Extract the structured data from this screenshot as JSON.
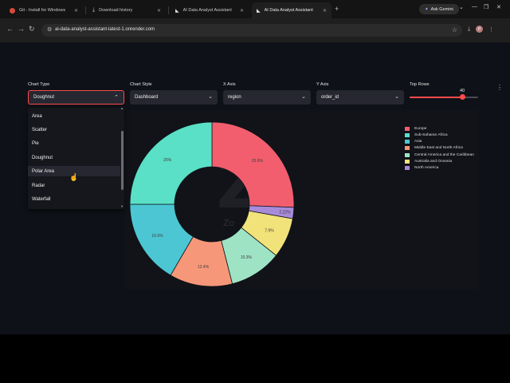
{
  "browser": {
    "tabs": [
      {
        "label": "Git - Install for Windows",
        "icon_color": "#d9493a",
        "active": false
      },
      {
        "label": "Download history",
        "icon_color": "#9aa0a6",
        "active": false
      },
      {
        "label": "AI Data Analyst Assistant",
        "icon_color": "#c8c8c8",
        "active": false
      },
      {
        "label": "AI Data Analyst Assistant",
        "icon_color": "#c8c8c8",
        "active": true
      }
    ],
    "new_tab": "+",
    "gemini_label": "Ask Gemini",
    "url": "ai-data-analyst-assistant-latest-1.onrender.com",
    "avatar_letter": "P"
  },
  "controls": {
    "chart_type": {
      "label": "Chart Type",
      "value": "Doughnut"
    },
    "chart_style": {
      "label": "Chart Style",
      "value": "Dashboard"
    },
    "x_axis": {
      "label": "X Axis",
      "value": "region"
    },
    "y_axis": {
      "label": "Y Axis",
      "value": "order_id"
    },
    "top_rows": {
      "label": "Top Rows",
      "value": "40",
      "fraction": 0.77
    }
  },
  "dropdown": {
    "options": [
      "Area",
      "Scatter",
      "Pie",
      "Doughnut",
      "Polar Area",
      "Radar",
      "Waterfall"
    ],
    "hovered": "Polar Area"
  },
  "watermark": {
    "big": "Z",
    "small": "Zo"
  },
  "chart_data": {
    "type": "pie",
    "variant": "doughnut",
    "legend_position": "right",
    "slices": [
      {
        "label": "Europe",
        "value": 25.6,
        "text": "25.6%",
        "color": "#f25e6e"
      },
      {
        "label": "Sub-Saharan Africa",
        "value": 2.22,
        "text": "2.22%",
        "color": "#a78bd9"
      },
      {
        "label": "Asia",
        "value": 7.9,
        "text": "7.9%",
        "color": "#f2e27a"
      },
      {
        "label": "Middle East and North Africa",
        "value": 10.3,
        "text": "10.3%",
        "color": "#9fe3c5"
      },
      {
        "label": "Central America and the Caribbean",
        "value": 12.4,
        "text": "12.4%",
        "color": "#f7977a"
      },
      {
        "label": "Australia and Oceania",
        "value": 16.6,
        "text": "16.6%",
        "color": "#4cc6d3"
      },
      {
        "label": "North America",
        "value": 25,
        "text": "25%",
        "color": "#59e0c6"
      }
    ],
    "legend": [
      {
        "label": "Europe",
        "color": "#f25e6e"
      },
      {
        "label": "Sub-Saharan Africa",
        "color": "#59e0c6"
      },
      {
        "label": "Asia",
        "color": "#4cc6d3"
      },
      {
        "label": "Middle East and North Africa",
        "color": "#f7977a"
      },
      {
        "label": "Central America and the Caribbean",
        "color": "#9fe3c5"
      },
      {
        "label": "Australia and Oceania",
        "color": "#f2e27a"
      },
      {
        "label": "North America",
        "color": "#a78bd9"
      }
    ]
  }
}
